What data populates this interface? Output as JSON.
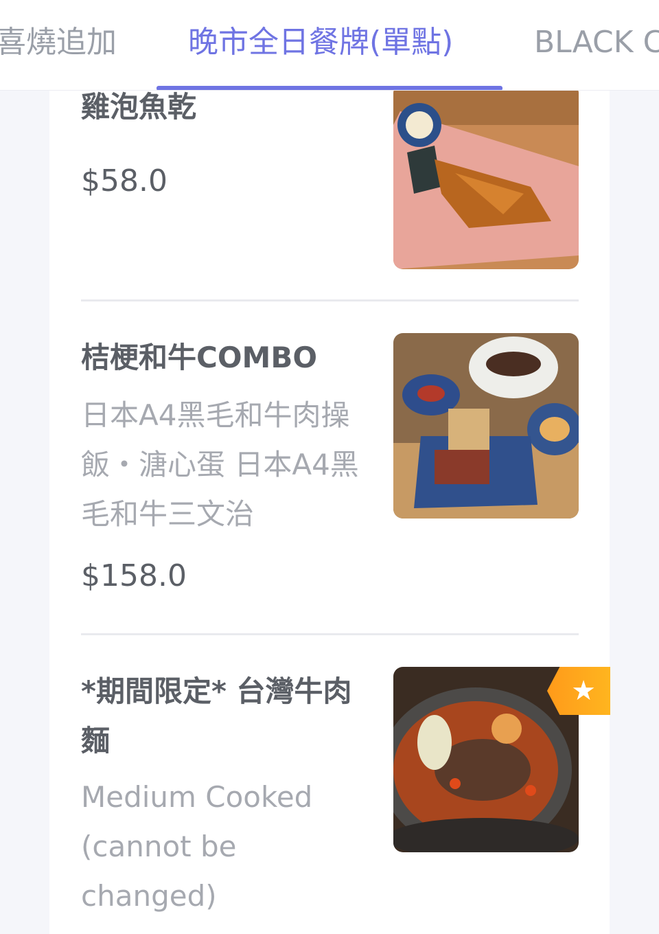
{
  "tabs": [
    {
      "label": "喜燒追加"
    },
    {
      "label": "晚市全日餐牌(單點)"
    },
    {
      "label": "BLACK C"
    }
  ],
  "accent_color": "#6f74e3",
  "menu_items": [
    {
      "name": "雞泡魚乾",
      "description": "",
      "price": "$58.0",
      "image": "dried-pufferfish-dish-photo"
    },
    {
      "name": "桔梗和牛COMBO",
      "description": "日本A4黑毛和牛肉操飯・溏心蛋 日本A4黑毛和牛三文治",
      "price": "$158.0",
      "image": "wagyu-combo-set-photo"
    },
    {
      "name": "*期間限定* 台灣牛肉麵",
      "description": "Medium Cooked (cannot be changed)",
      "price": "",
      "image": "taiwan-beef-noodle-photo",
      "badge_icon": "star-icon",
      "badge_symbol": "★"
    }
  ]
}
